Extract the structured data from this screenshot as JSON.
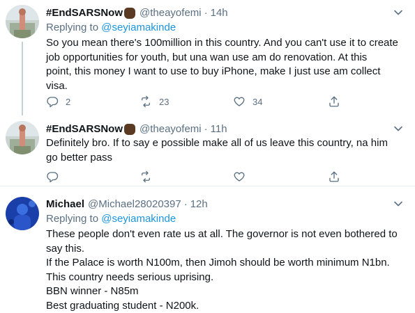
{
  "tweets": [
    {
      "name": "#EndSARSNow",
      "handle": "@theayofemi",
      "separator": "·",
      "time": "14h",
      "replying_prefix": "Replying to",
      "replying_to": "@seyiamakinde",
      "lines": [
        "So you mean there's 100million in this country. And you can't use it to create",
        "job opportunities for youth, but una wan use am do renovation. At this",
        "point, this money I want to use to buy iPhone, make I just use am collect",
        "visa."
      ],
      "replies": "2",
      "retweets": "23",
      "likes": "34"
    },
    {
      "name": "#EndSARSNow",
      "handle": "@theayofemi",
      "separator": "·",
      "time": "11h",
      "lines": [
        "Definitely bro. If to say e possible make all of us leave this country, na him",
        "go better pass"
      ]
    },
    {
      "name": "Michael",
      "handle": "@Michael28020397",
      "separator": "·",
      "time": "12h",
      "replying_prefix": "Replying to",
      "replying_to": "@seyiamakinde",
      "lines": [
        "These people don't even rate us at all. The governor is not even bothered to",
        "say this.",
        "If the Palace is worth N100m, then Jimoh should be worth minimum N1bn.",
        "This country needs serious uprising.",
        "BBN winner - N85m",
        "Best graduating student - N200k."
      ]
    }
  ],
  "icons": {
    "reply": "reply-icon",
    "retweet": "retweet-icon",
    "like": "heart-icon",
    "share": "share-icon",
    "caret": "chevron-down-icon",
    "emoji": "raised-fist-dark-skin-icon"
  },
  "colors": {
    "text": "#0f1419",
    "secondary": "#5b7083",
    "link": "#1b95e0",
    "divider": "#e6ecf0",
    "thread_line": "#c4cfd6"
  }
}
